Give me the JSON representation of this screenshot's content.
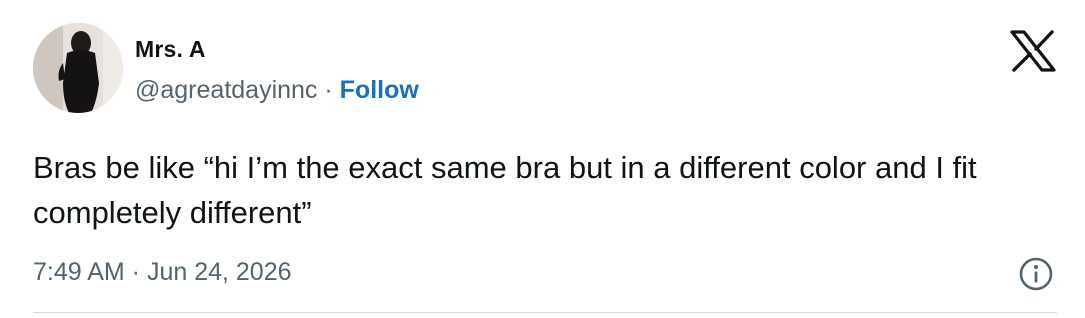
{
  "author": {
    "display_name": "Mrs. A",
    "handle": "@agreatdayinnc",
    "separator": "·",
    "follow_label": "Follow"
  },
  "tweet": {
    "text": "Bras be like “hi I’m the exact same bra but in a different color and I fit completely different”",
    "timestamp": "7:49 AM · Jun 24, 2026"
  },
  "icons": {
    "brand": "x-logo-icon",
    "info": "info-icon"
  },
  "colors": {
    "follow": "#1d70b8",
    "secondary_text": "#536471",
    "primary_text": "#0f1419"
  }
}
